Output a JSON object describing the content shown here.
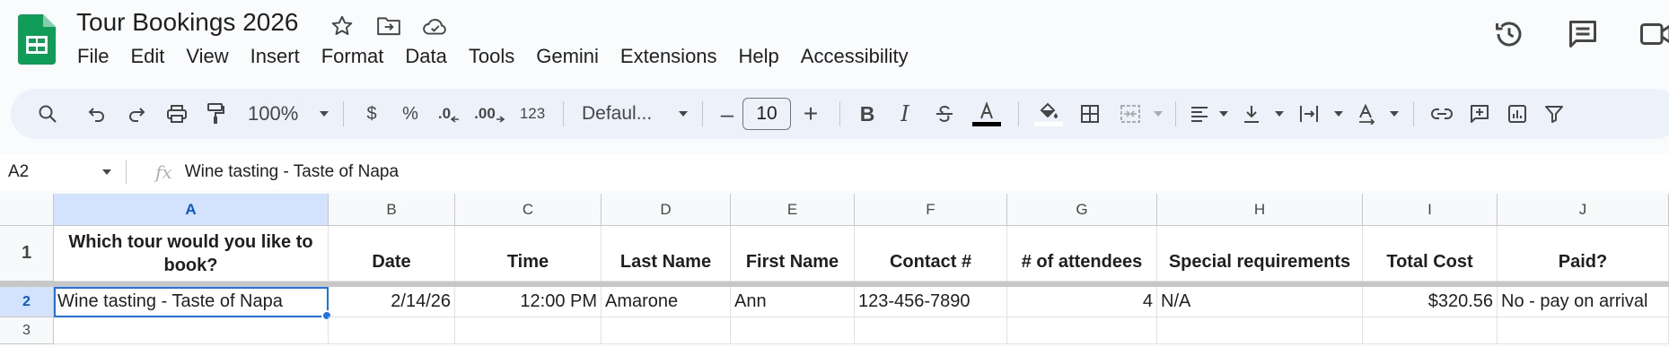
{
  "doc": {
    "title": "Tour Bookings 2026",
    "menu": [
      "File",
      "Edit",
      "View",
      "Insert",
      "Format",
      "Data",
      "Tools",
      "Gemini",
      "Extensions",
      "Help",
      "Accessibility"
    ]
  },
  "toolbar": {
    "zoom": "100%",
    "currency": "$",
    "percent": "%",
    "dec_decrease": ".0",
    "dec_increase": ".00",
    "number_format": "123",
    "font": "Defaul...",
    "font_size": "10",
    "minus": "–",
    "plus": "+",
    "bold": "B",
    "italic": "I"
  },
  "formula_bar": {
    "name_box": "A2",
    "fx": "fx",
    "content": "Wine tasting - Taste of Napa"
  },
  "columns": [
    "A",
    "B",
    "C",
    "D",
    "E",
    "F",
    "G",
    "H",
    "I",
    "J"
  ],
  "rows": [
    {
      "num": "1",
      "cells": [
        "Which tour would you like to book?",
        "Date",
        "Time",
        "Last Name",
        "First Name",
        "Contact #",
        "# of attendees",
        "Special requirements",
        "Total Cost",
        "Paid?"
      ]
    },
    {
      "num": "2",
      "cells": [
        "Wine tasting - Taste of Napa",
        "2/14/26",
        "12:00 PM",
        "Amarone",
        "Ann",
        "123-456-7890",
        "4",
        "N/A",
        "$320.56",
        "No - pay on arrival"
      ]
    },
    {
      "num": "3",
      "cells": [
        "",
        "",
        "",
        "",
        "",
        "",
        "",
        "",
        "",
        ""
      ]
    }
  ],
  "colors": {
    "accent": "#1a73e8",
    "selected_header": "#d3e3fd",
    "toolbar_bg": "#edf2fa",
    "sheets_green": "#0f9d58"
  },
  "icons": [
    "sheets-logo-icon",
    "star-icon",
    "move-to-folder-icon",
    "cloud-saved-icon",
    "history-icon",
    "comments-icon",
    "meet-icon"
  ]
}
